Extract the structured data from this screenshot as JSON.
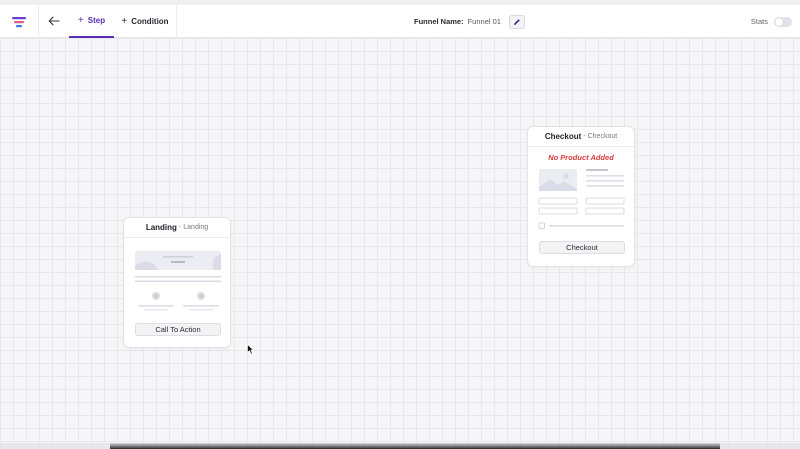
{
  "header": {
    "tabs": [
      {
        "label": "Step",
        "active": true
      },
      {
        "label": "Condition",
        "active": false
      }
    ],
    "funnel_name_label": "Funnel Name:",
    "funnel_name_value": "Funnel 01",
    "stats_label": "Stats",
    "stats_enabled": false,
    "accent_color": "#5a2fb5"
  },
  "nodes": {
    "landing": {
      "name": "Landing",
      "separator": "-",
      "type": "Landing",
      "button_label": "Call To Action"
    },
    "checkout": {
      "name": "Checkout",
      "separator": "-",
      "type": "Checkout",
      "warning": "No Product Added",
      "button_label": "Checkout",
      "warning_color": "#d93a3a"
    }
  },
  "icons": [
    "funnel-logo-icon",
    "back-arrow-icon",
    "plus-icon",
    "pencil-icon",
    "toggle-switch",
    "mouse-cursor-icon"
  ]
}
